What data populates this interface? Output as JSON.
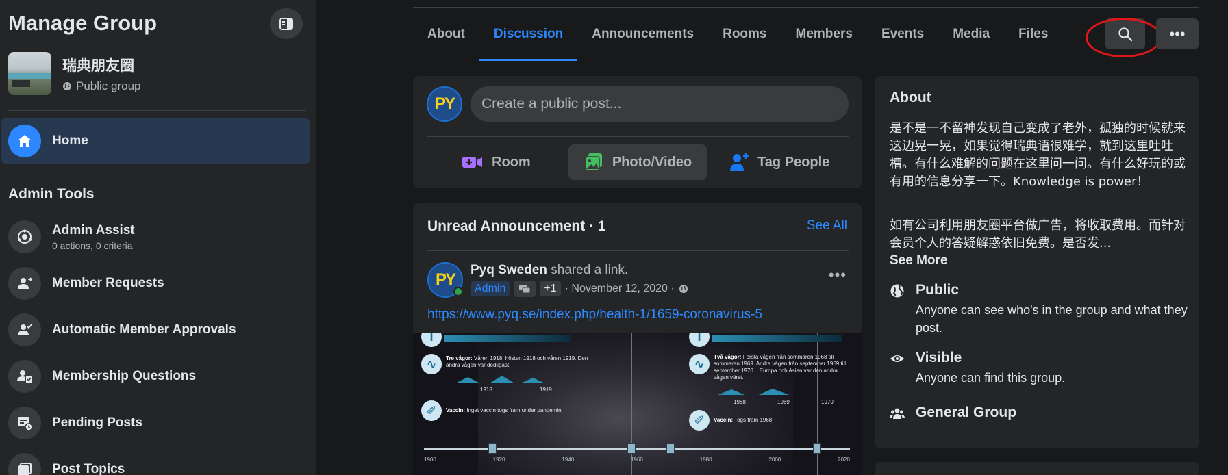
{
  "sidebar": {
    "title": "Manage Group",
    "group_name": "瑞典朋友圈",
    "group_type": "Public group",
    "home_label": "Home",
    "admin_tools_heading": "Admin Tools",
    "tools": [
      {
        "label": "Admin Assist",
        "sub": "0 actions, 0 criteria",
        "icon": "admin-assist-icon"
      },
      {
        "label": "Member Requests",
        "icon": "member-requests-icon"
      },
      {
        "label": "Automatic Member Approvals",
        "icon": "auto-approvals-icon"
      },
      {
        "label": "Membership Questions",
        "icon": "membership-questions-icon"
      },
      {
        "label": "Pending Posts",
        "icon": "pending-posts-icon"
      },
      {
        "label": "Post Topics",
        "icon": "post-topics-icon"
      }
    ]
  },
  "tabs": [
    "About",
    "Discussion",
    "Announcements",
    "Rooms",
    "Members",
    "Events",
    "Media",
    "Files"
  ],
  "active_tab": "Discussion",
  "composer": {
    "avatar_text": "PY",
    "placeholder": "Create a public post...",
    "actions": [
      "Room",
      "Photo/Video",
      "Tag People"
    ]
  },
  "announcement": {
    "title": "Unread Announcement · 1",
    "see_all": "See All",
    "poster_name": "Pyq Sweden",
    "poster_action": "shared a link.",
    "badge_admin": "Admin",
    "badge_plus": "+1",
    "date": "· November 12, 2020 ·",
    "link": "https://www.pyq.se/index.php/health-1/1659-coronavirus-5",
    "infographic": {
      "left_waves_title": "Tre vågor:",
      "left_waves_text": "Våren 1918, hösten 1918 och våren 1919. Den andra vågen var dödligast.",
      "left_vaccine_title": "Vaccin:",
      "left_vaccine_text": "Inget vaccin togs fram under pandemin.",
      "right_waves_title": "Två vågor:",
      "right_waves_text": "Första vågen från sommaren 1968 till sommaren 1969. Andra vågen från september 1969 till september 1970. I Europa och Asien var den andra vågen värst.",
      "right_vaccine_title": "Vaccin:",
      "right_vaccine_text": "Togs fram 1968.",
      "wave_labels_left": [
        "1918",
        "1919"
      ],
      "wave_labels_right": [
        "1968",
        "1969",
        "1970"
      ],
      "axis_ticks": [
        "1900",
        "1920",
        "1940",
        "1960",
        "1980",
        "2000",
        "2020"
      ]
    }
  },
  "about": {
    "title": "About",
    "description_1": "是不是一不留神发现自己变成了老外，孤独的时候就来这边晃一晃，如果觉得瑞典语很难学，就到这里吐吐槽。有什么难解的问题在这里问一问。有什么好玩的或有用的信息分享一下。Knowledge is power！",
    "description_2": "如有公司利用朋友圈平台做广告，将收取费用。而针对会员个人的答疑解惑依旧免费。是否发...",
    "see_more": "See More",
    "public_head": "Public",
    "public_sub": "Anyone can see who's in the group and what they post.",
    "visible_head": "Visible",
    "visible_sub": "Anyone can find this group.",
    "general_head": "General Group"
  },
  "colors": {
    "accent": "#2d88ff",
    "background": "#18191a",
    "card": "#242526",
    "highlight_ring": "#e0161b"
  }
}
